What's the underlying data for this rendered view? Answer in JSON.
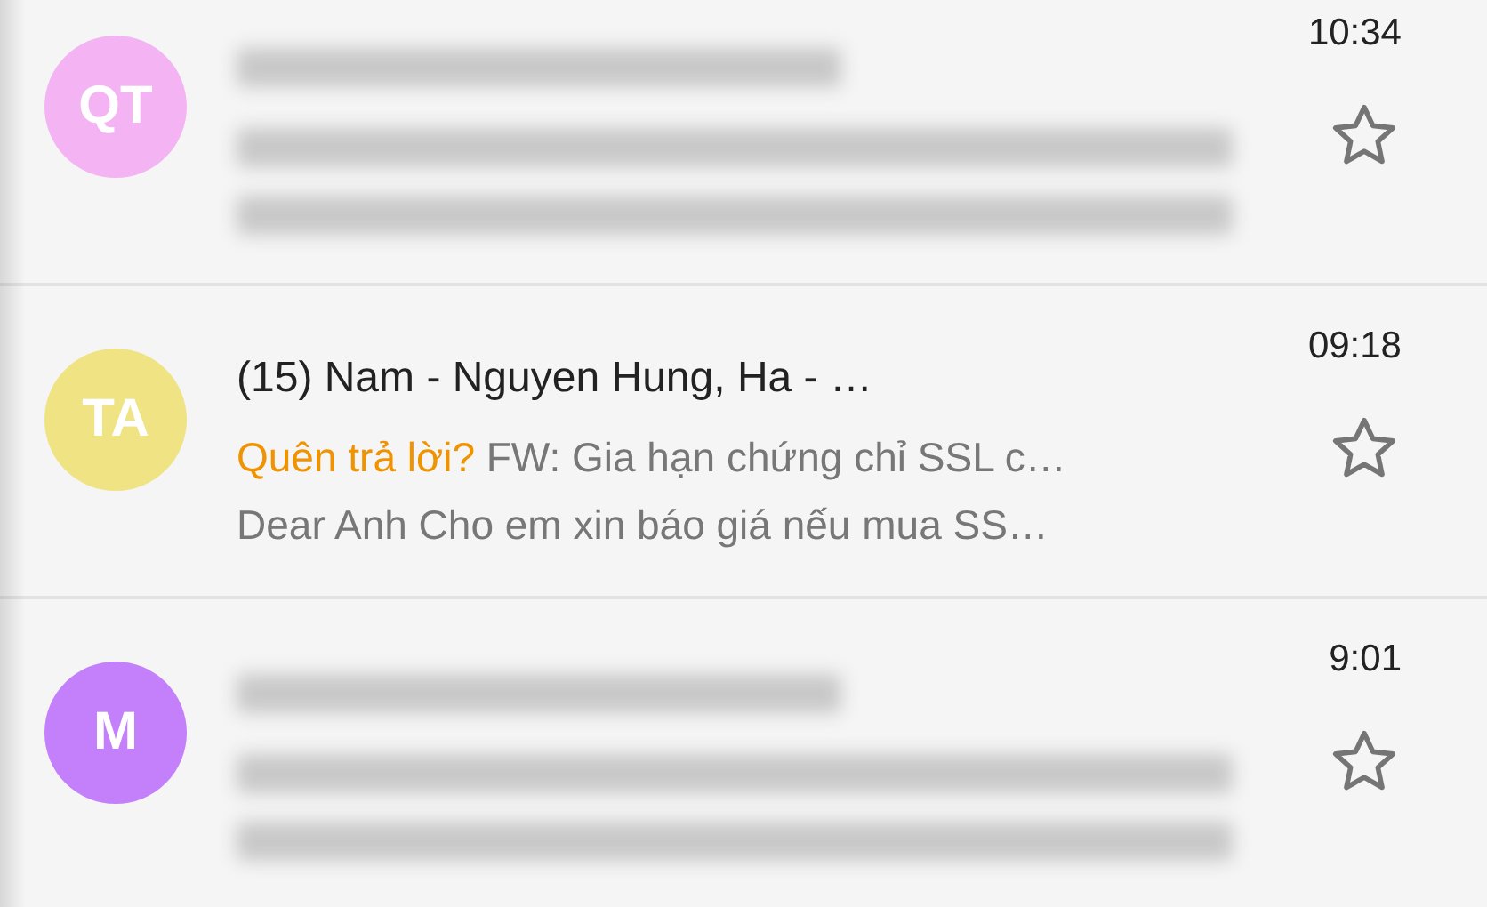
{
  "messages": [
    {
      "initials": "QT",
      "color": "#f4b3f2",
      "blurred": true,
      "time": "10:34",
      "starred": false
    },
    {
      "initials": "TA",
      "color": "#efe383",
      "blurred": false,
      "sender": "(15) Nam - Nguyen Hung, Ha - …",
      "label": "Quên trả lời?",
      "subject": "FW: Gia hạn chứng chỉ SSL c…",
      "snippet": "Dear Anh Cho em xin báo giá nếu mua SS…",
      "time": "09:18",
      "starred": false
    },
    {
      "initials": "M",
      "color": "#c47ffb",
      "blurred": true,
      "time": "9:01",
      "starred": false
    }
  ]
}
